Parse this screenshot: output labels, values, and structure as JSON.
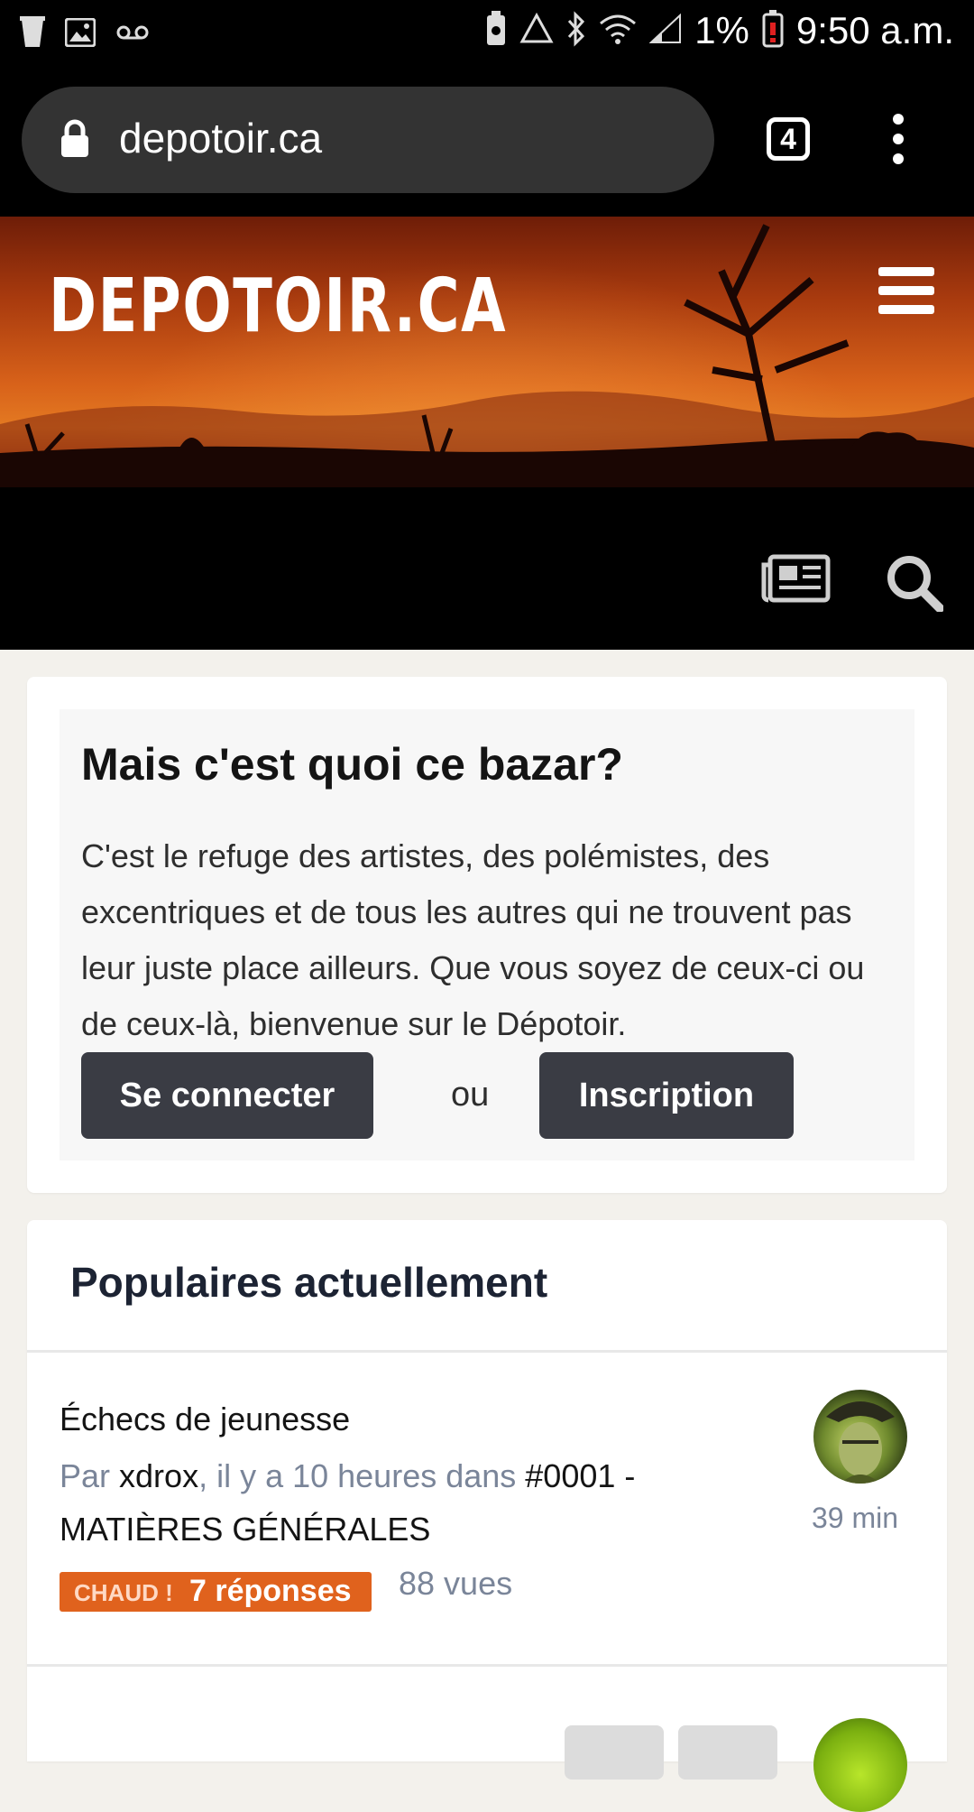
{
  "status_bar": {
    "battery_percent": "1%",
    "time": "9:50 a.m."
  },
  "browser": {
    "url": "depotoir.ca",
    "tab_count": "4"
  },
  "site": {
    "logo_text": "DEPOTOIR.CA"
  },
  "welcome": {
    "title": "Mais c'est quoi ce bazar?",
    "text": "C'est le refuge des artistes, des polémistes, des excentriques et de tous les autres qui ne trouvent pas leur juste place ailleurs. Que vous soyez de ceux-ci ou de ceux-là, bienvenue sur le Dépotoir.",
    "login_label": "Se connecter",
    "or_label": "ou",
    "register_label": "Inscription"
  },
  "popular": {
    "title": "Populaires actuellement",
    "topics": [
      {
        "title": "Échecs de jeunesse",
        "by_prefix": "Par ",
        "author": "xdrox",
        "time_text": ", il y a 10 heures dans ",
        "forum": "#0001 - MATIÈRES GÉNÉRALES",
        "hot_label": "CHAUD !",
        "replies": "7 réponses",
        "views": "88 vues",
        "last_post": "39 min"
      }
    ]
  },
  "colors": {
    "hot_badge": "#e0621d",
    "button": "#3a3c44",
    "meta_text": "#7a8599"
  }
}
